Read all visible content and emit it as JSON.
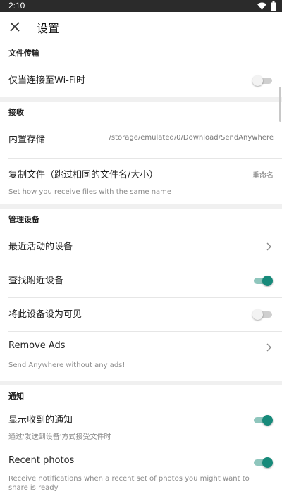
{
  "status": {
    "time": "2:10"
  },
  "appbar": {
    "title": "设置"
  },
  "sections": {
    "transfer": {
      "header": "文件传输",
      "wifi_only": {
        "label": "仅当连接至Wi-Fi时",
        "on": false
      }
    },
    "receive": {
      "header": "接收",
      "storage": {
        "label": "内置存储",
        "value": "/storage/emulated/0/Download/SendAnywhere"
      },
      "duplicate": {
        "label": "复制文件（跳过相同的文件名/大小）",
        "value": "重命名",
        "desc": "Set how you receive files with the same name"
      }
    },
    "devices": {
      "header": "管理设备",
      "recent": {
        "label": "最近活动的设备"
      },
      "nearby": {
        "label": "查找附近设备",
        "on": true
      },
      "visible": {
        "label": "将此设备设为可见",
        "on": false
      },
      "remove_ads": {
        "label": "Remove Ads",
        "desc": "Send Anywhere without any ads!"
      }
    },
    "notify": {
      "header": "通知",
      "show": {
        "label": "显示收到的通知",
        "desc": "通过'发送到设备'方式接受文件时",
        "on": true
      },
      "photos": {
        "label": "Recent photos",
        "desc": "Receive notifications when a recent set of photos you might want to share is ready",
        "on": true
      }
    }
  }
}
